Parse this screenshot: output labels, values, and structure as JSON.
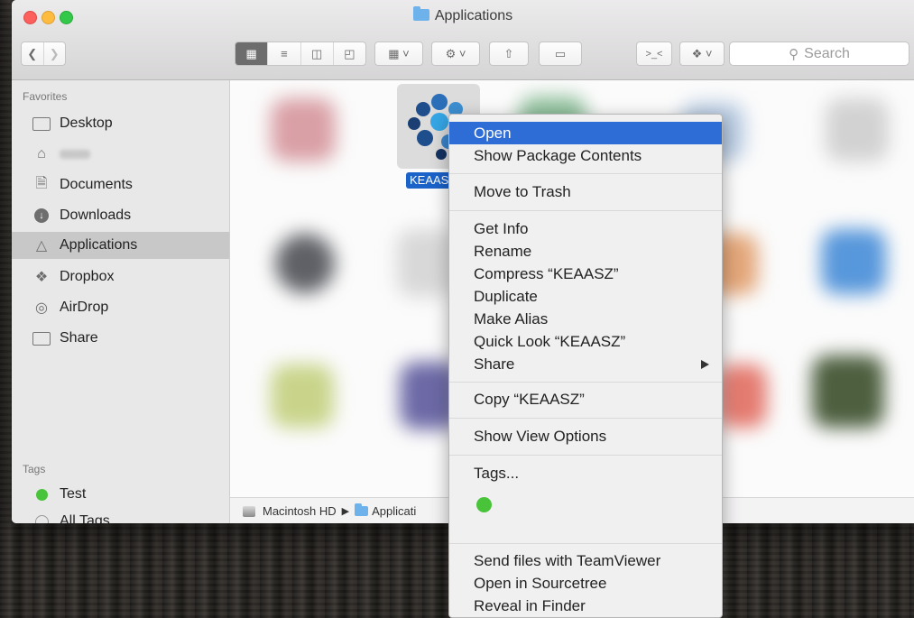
{
  "window": {
    "title": "Applications",
    "search_placeholder": "Search"
  },
  "sidebar": {
    "favorites_heading": "Favorites",
    "items": [
      {
        "label": "Desktop",
        "icon": "desktop-icon"
      },
      {
        "label": "",
        "icon": "home-icon"
      },
      {
        "label": "Documents",
        "icon": "documents-icon"
      },
      {
        "label": "Downloads",
        "icon": "downloads-icon"
      },
      {
        "label": "Applications",
        "icon": "applications-icon"
      },
      {
        "label": "Dropbox",
        "icon": "dropbox-icon"
      },
      {
        "label": "AirDrop",
        "icon": "airdrop-icon"
      },
      {
        "label": "Share",
        "icon": "folder-icon"
      }
    ],
    "tags_heading": "Tags",
    "tags": [
      {
        "label": "Test",
        "color": "#49c43a"
      },
      {
        "label": "All Tags",
        "color": "#cccccc"
      }
    ]
  },
  "content": {
    "selected_app_label": "KEAASZ"
  },
  "pathbar": {
    "segments": [
      "Macintosh HD",
      "Applicati"
    ]
  },
  "context_menu": {
    "items": [
      {
        "label": "Open"
      },
      {
        "label": "Show Package Contents"
      },
      {
        "label": "Move to Trash"
      },
      {
        "label": "Get Info"
      },
      {
        "label": "Rename"
      },
      {
        "label": "Compress “KEAASZ”"
      },
      {
        "label": "Duplicate"
      },
      {
        "label": "Make Alias"
      },
      {
        "label": "Quick Look “KEAASZ”"
      },
      {
        "label": "Share"
      },
      {
        "label": "Copy “KEAASZ”"
      },
      {
        "label": "Show View Options"
      },
      {
        "label": "Tags..."
      },
      {
        "label": "Send files with TeamViewer"
      },
      {
        "label": "Open in Sourcetree"
      },
      {
        "label": "Reveal in Finder"
      }
    ],
    "tag_color": "#49c43a",
    "highlight_color": "#2f6dd6"
  }
}
